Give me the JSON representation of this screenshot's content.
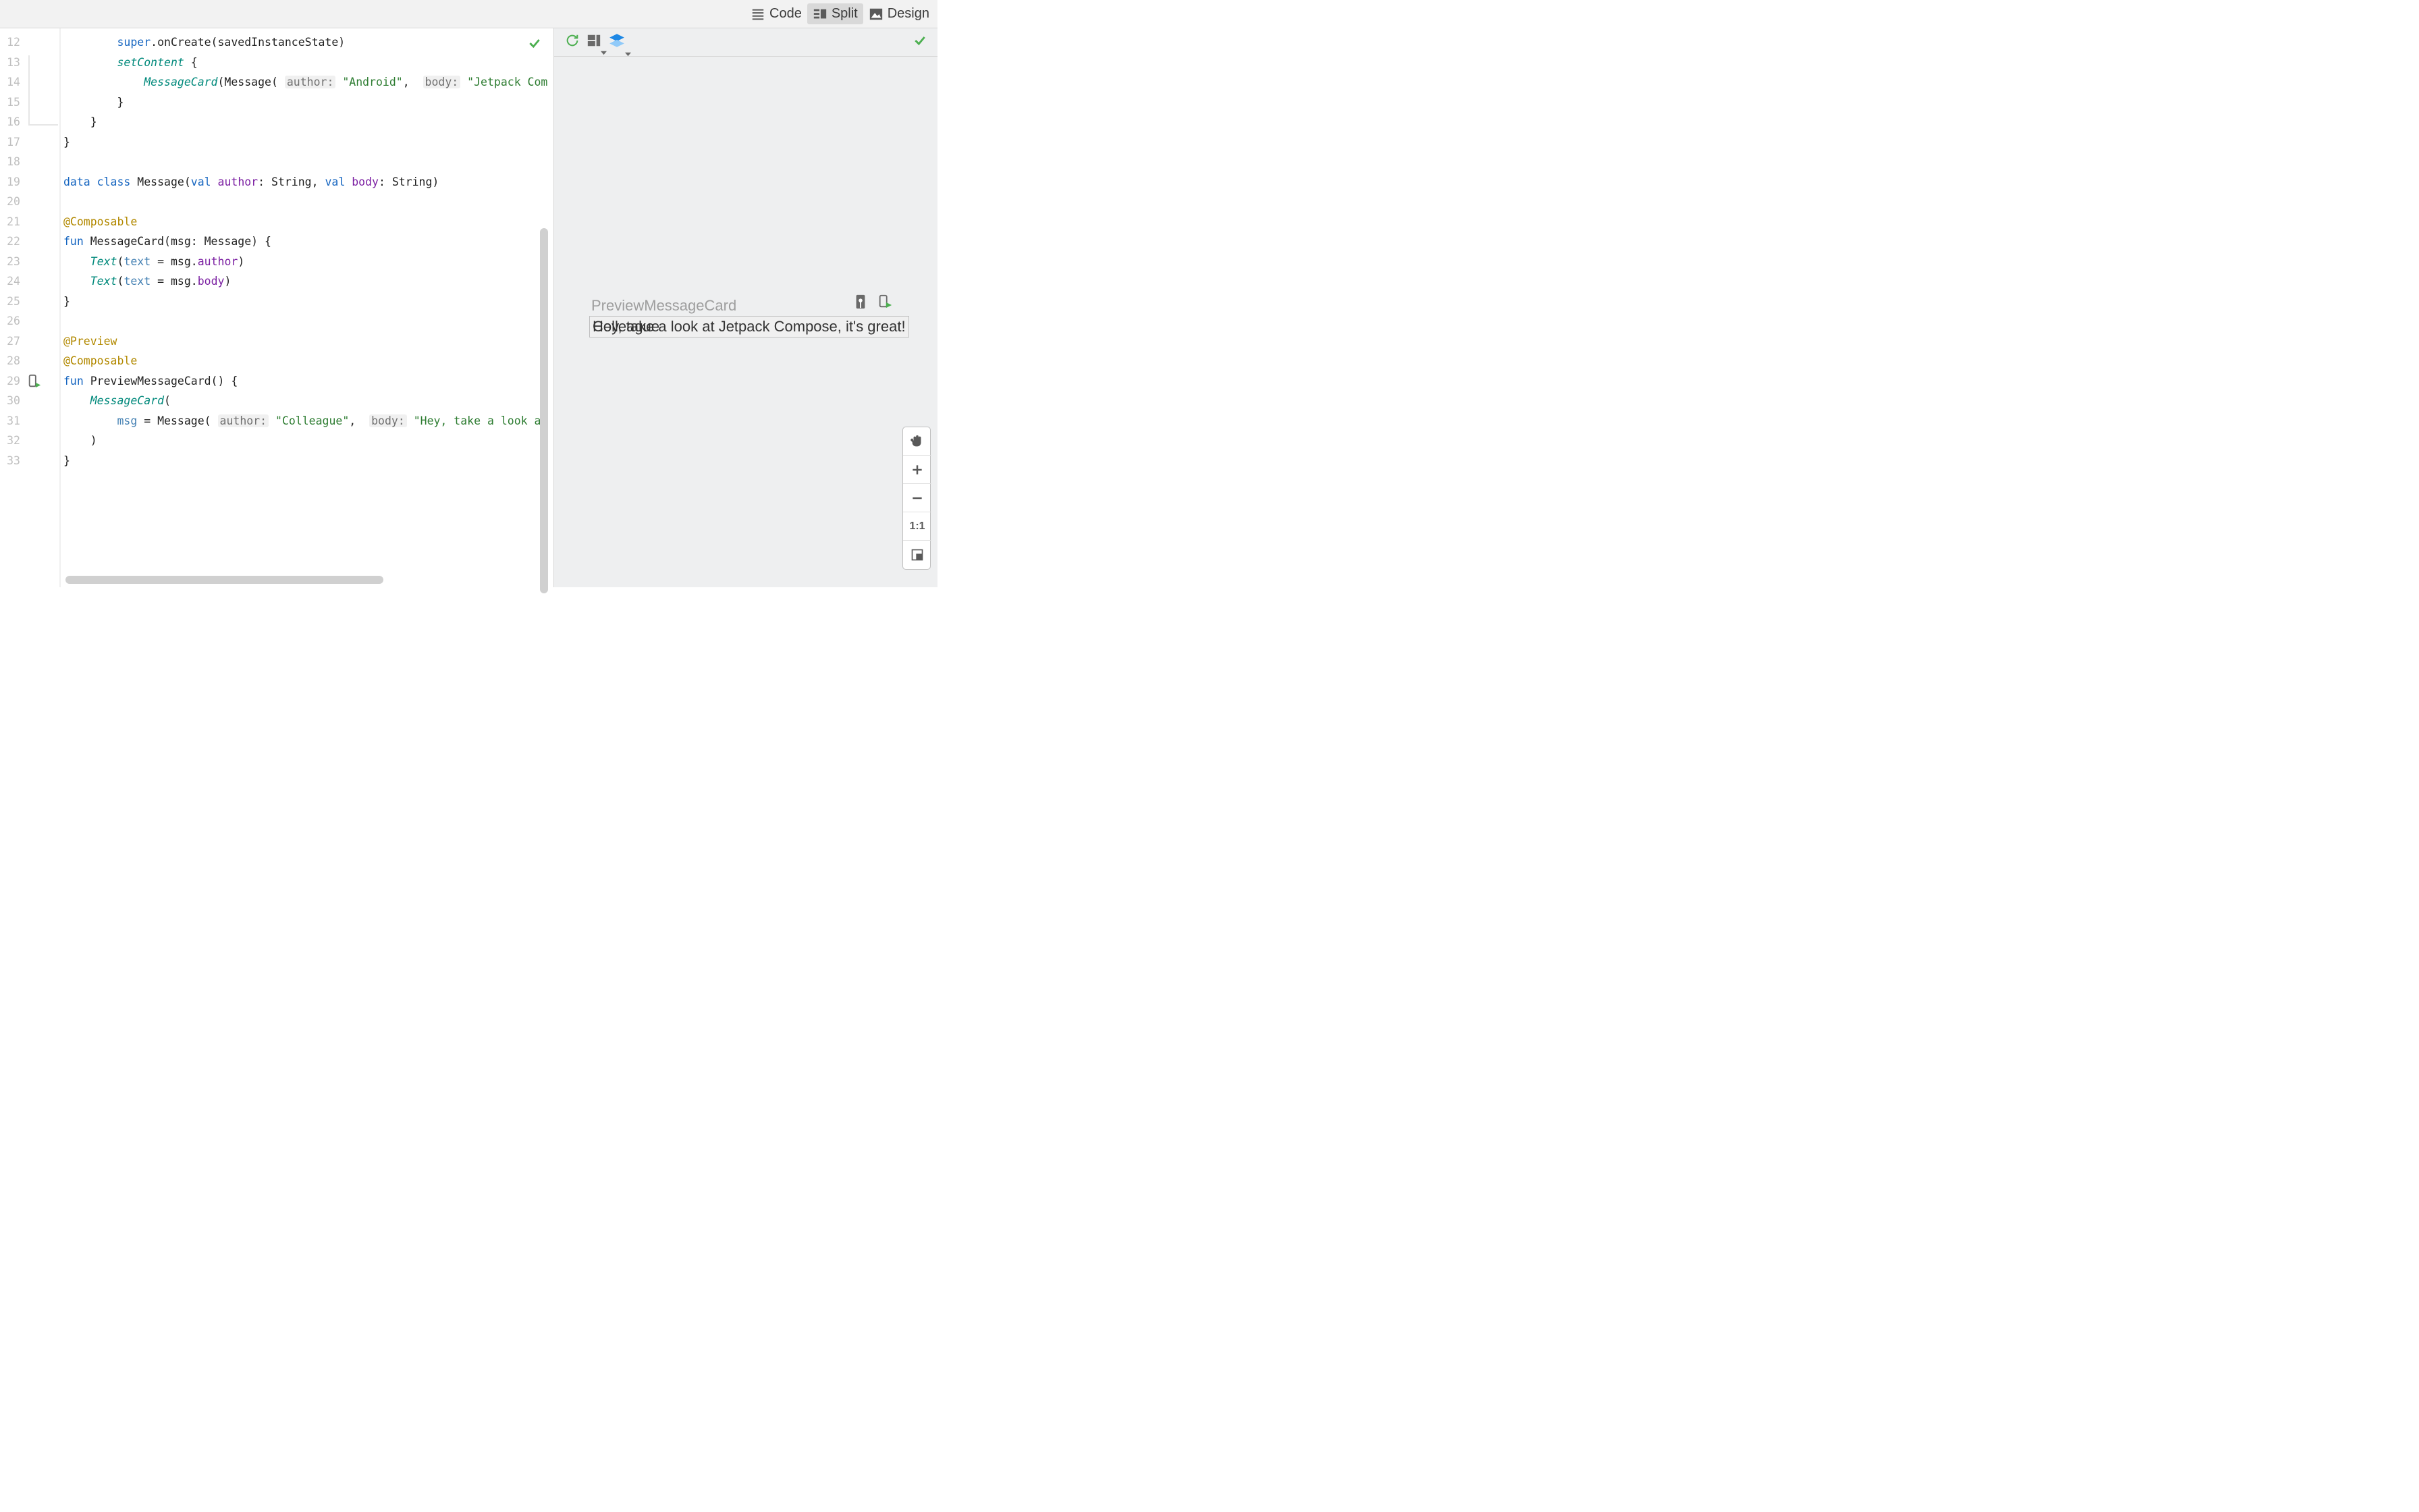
{
  "tabs": {
    "code": "Code",
    "split": "Split",
    "design": "Design"
  },
  "gutter": {
    "start": 12,
    "end": 33
  },
  "colors": {
    "keyword": "#1565c0",
    "annotation": "#b28900",
    "function": "#00897b",
    "string": "#2e7d32",
    "hint_bg": "#f0f0f0"
  },
  "code": {
    "l12": {
      "kw1": "super",
      "m": ".onCreate(savedInstanceState)"
    },
    "l13": {
      "fn": "setContent",
      "b": " {"
    },
    "l14": {
      "fn": "MessageCard",
      "p1": "(Message( ",
      "h1": "author:",
      "s1": " \"Android\"",
      "c": ", ",
      "h2": "body:",
      "s2": " \"Jetpack Com"
    },
    "l15": "}",
    "l16": "}",
    "l17": "}",
    "l19": {
      "kw1": "data",
      "kw2": " class",
      "n": " Message(",
      "kw3": "val",
      "a1": " author",
      "t1": ": String, ",
      "kw4": "val",
      "a2": " body",
      "t2": ": String)"
    },
    "l21": "@Composable",
    "l22": {
      "kw": "fun",
      "n": " MessageCard(msg: Message) {"
    },
    "l23": {
      "fn": "Text",
      "p1": "(",
      "a": "text",
      "e": " = msg.",
      "prop": "author",
      "p2": ")"
    },
    "l24": {
      "fn": "Text",
      "p1": "(",
      "a": "text",
      "e": " = msg.",
      "prop": "body",
      "p2": ")"
    },
    "l25": "}",
    "l27": "@Preview",
    "l28": "@Composable",
    "l29": {
      "kw": "fun",
      "n": " PreviewMessageCard() {"
    },
    "l30": {
      "fn": "MessageCard",
      "p": "("
    },
    "l31": {
      "a": "msg",
      "e": " = Message( ",
      "h1": "author:",
      "s1": " \"Colleague\"",
      "c": ", ",
      "h2": "body:",
      "s2": " \"Hey, take a look at"
    },
    "l32": ")",
    "l33": "}"
  },
  "preview": {
    "title": "PreviewMessageCard",
    "text": "Hey, take a look at Jetpack Compose, it's great!",
    "overlap": "Colleague"
  },
  "zoom": {
    "ratio": "1:1"
  }
}
